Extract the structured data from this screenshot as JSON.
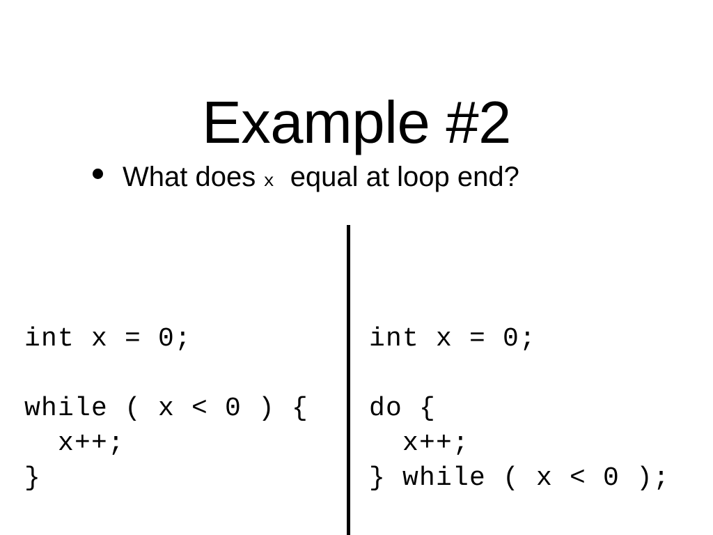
{
  "slide": {
    "title": "Example #2",
    "background_color": "#ffffff",
    "text_color": "#000000",
    "bullet": {
      "marker": "bullet-dot",
      "text_before": "What does",
      "code_term": "x",
      "text_after": "equal at loop end?"
    },
    "divider": {
      "name": "vertical-rule",
      "color": "#000000"
    },
    "code_columns": [
      {
        "id": "left",
        "label": "while-loop-example",
        "lines": [
          "int x = 0;",
          "",
          "while ( x < 0 ) {",
          "  x++;",
          "}"
        ]
      },
      {
        "id": "right",
        "label": "do-while-loop-example",
        "lines": [
          "int x = 0;",
          "",
          "do {",
          "  x++;",
          "} while ( x < 0 );"
        ]
      }
    ]
  }
}
